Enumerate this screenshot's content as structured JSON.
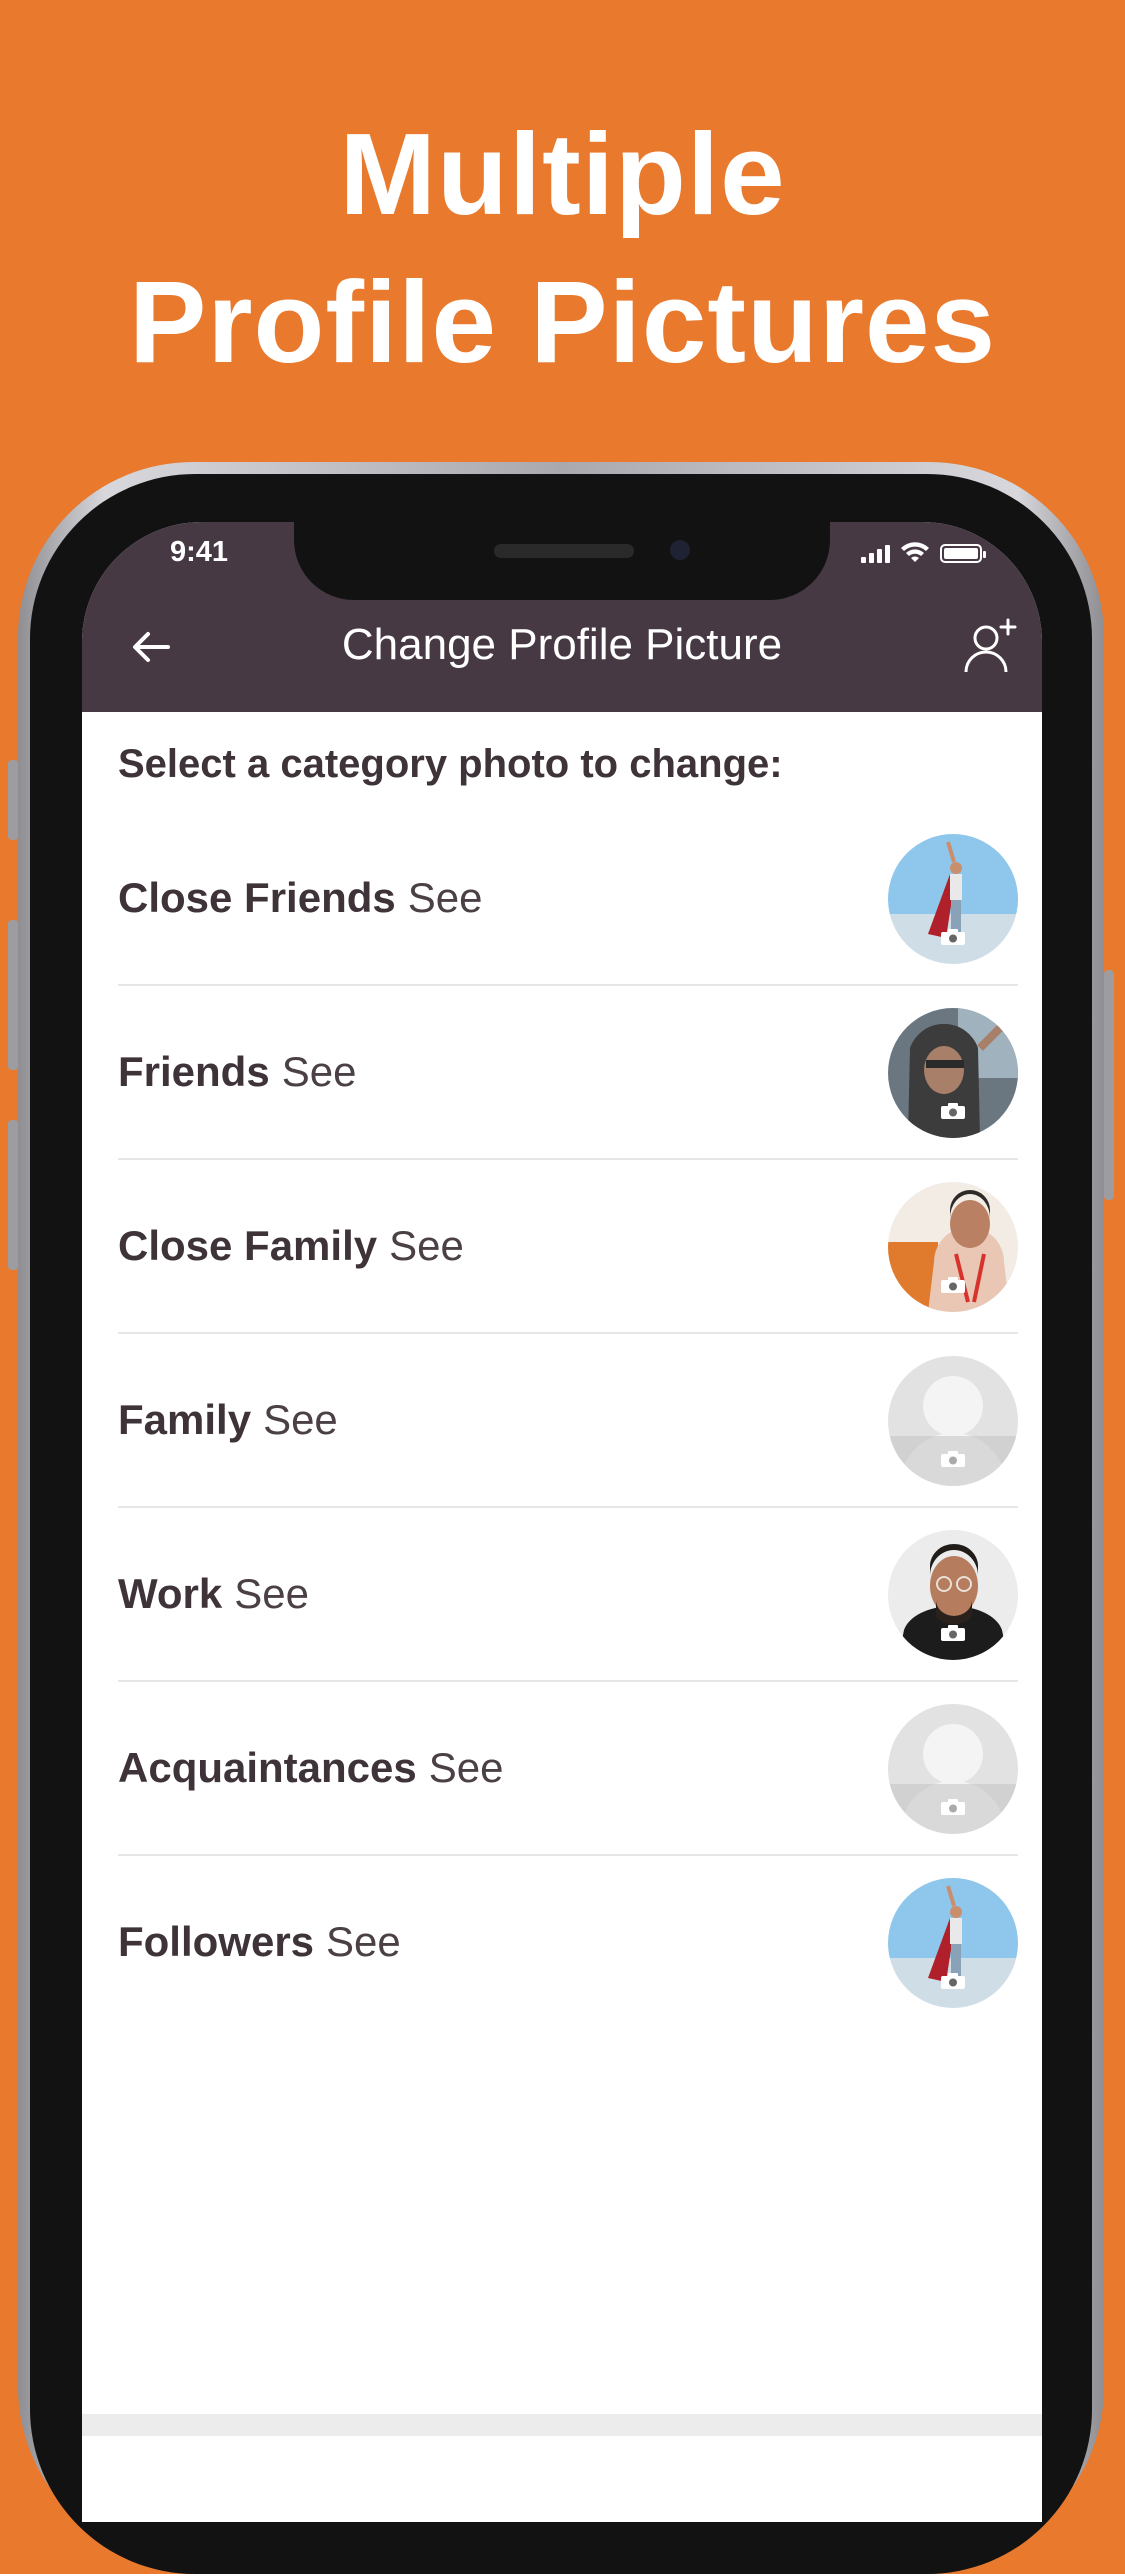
{
  "headline": {
    "line1": "Multiple",
    "line2": "Profile Pictures"
  },
  "status_bar": {
    "time": "9:41"
  },
  "header": {
    "title": "Change Profile Picture"
  },
  "subtitle": "Select a category photo to change:",
  "categories": [
    {
      "name": "Close Friends",
      "action": "See",
      "photo": "superhero-photo"
    },
    {
      "name": "Friends",
      "action": "See",
      "photo": "hood-selfie-photo"
    },
    {
      "name": "Close Family",
      "action": "See",
      "photo": "smiling-man-photo"
    },
    {
      "name": "Family",
      "action": "See",
      "photo": "placeholder-avatar"
    },
    {
      "name": "Work",
      "action": "See",
      "photo": "glasses-man-photo"
    },
    {
      "name": "Acquaintances",
      "action": "See",
      "photo": "placeholder-avatar"
    },
    {
      "name": "Followers",
      "action": "See",
      "photo": "superhero-photo"
    }
  ],
  "icons": {
    "back": "arrow-left-icon",
    "add_user": "add-user-icon",
    "camera": "camera-icon"
  },
  "colors": {
    "background": "#E8792D",
    "header": "#463943",
    "text": "#3e3339"
  }
}
